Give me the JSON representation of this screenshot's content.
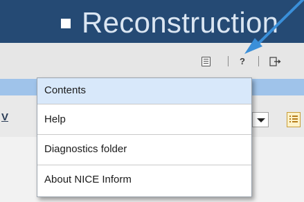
{
  "header": {
    "title": "Reconstruction",
    "background_color": "#254a74",
    "title_color": "#dbe6f2"
  },
  "toolbar": {
    "icons": [
      "list-icon",
      "help-icon",
      "logout-icon"
    ],
    "help_glyph": "?"
  },
  "background": {
    "left_letter": "V",
    "accent_band_color": "#9fc3ea"
  },
  "help_menu": {
    "items": [
      {
        "label": "Contents",
        "highlighted": true
      },
      {
        "label": "Help",
        "highlighted": false
      },
      {
        "label": "Diagnostics folder",
        "highlighted": false
      },
      {
        "label": "About NICE Inform",
        "highlighted": false
      }
    ],
    "highlight_color": "#d8e8fa"
  },
  "annotation": {
    "type": "pointer-arrow",
    "color": "#3a8fd9",
    "target": "help-icon"
  }
}
